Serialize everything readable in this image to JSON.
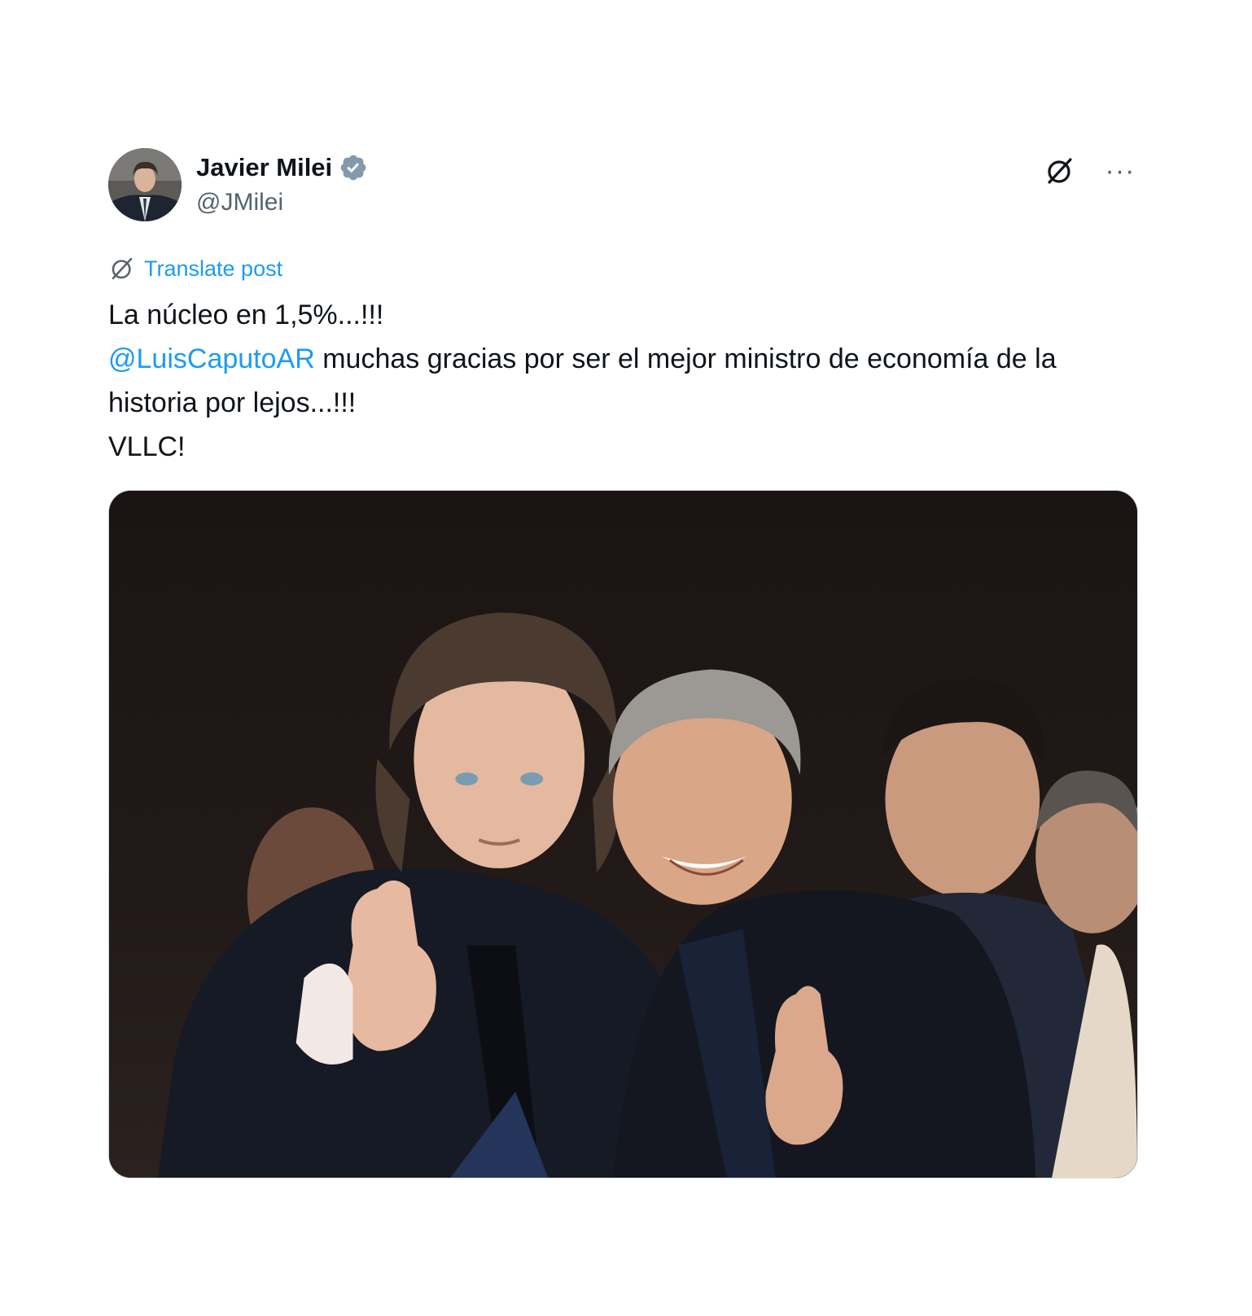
{
  "author": {
    "display_name": "Javier Milei",
    "handle": "@JMilei",
    "verified": true,
    "verified_icon": "verified-badge-icon",
    "avatar_icon": "avatar"
  },
  "header_actions": {
    "grok_icon": "grok-icon",
    "more_label": "···"
  },
  "translate": {
    "icon": "grok-icon",
    "label": "Translate post"
  },
  "post": {
    "line1": "La núcleo en 1,5%...!!!",
    "mention": "@LuisCaputoAR",
    "line2_rest": " muchas gracias por ser el mejor ministro de economía de la historia por lejos...!!!",
    "line3": "VLLC!"
  },
  "media": {
    "alt": "",
    "icon": "photo"
  },
  "colors": {
    "accent": "#1d9bf0",
    "text": "#0f1419",
    "secondary": "#536471"
  }
}
